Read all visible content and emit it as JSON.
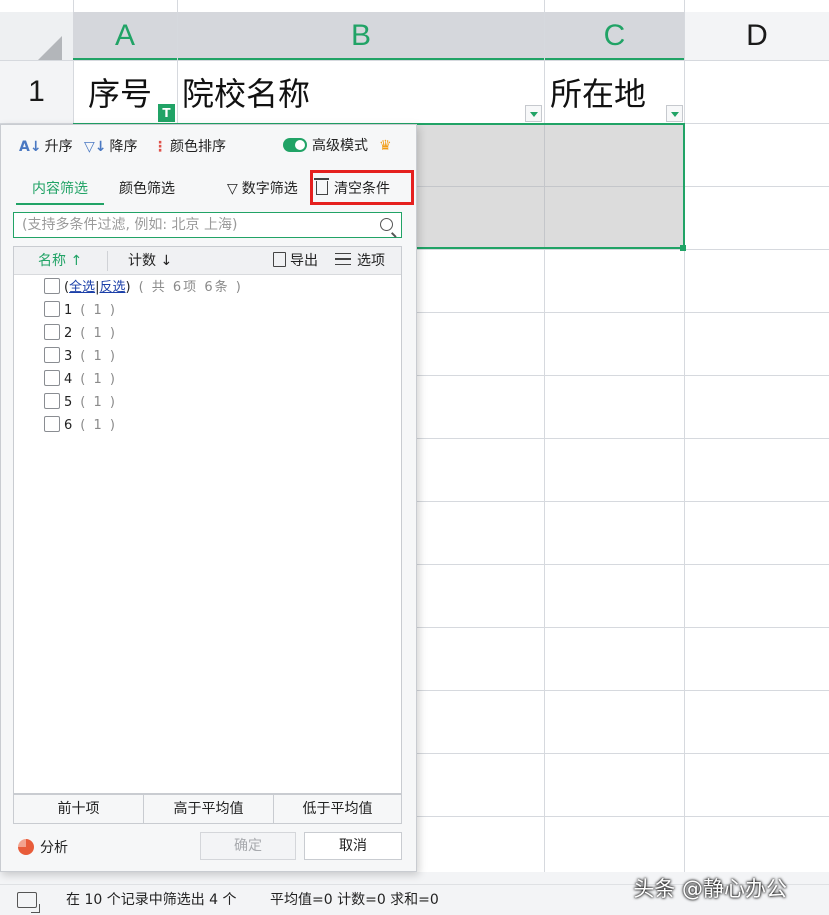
{
  "spreadsheet": {
    "columns": [
      "A",
      "B",
      "C",
      "D"
    ],
    "row_number": "1",
    "headers": {
      "a": "序号",
      "b": "院校名称",
      "c": "所在地"
    },
    "filter_active_icon": "T"
  },
  "filter_panel": {
    "sort": {
      "ascending": "升序",
      "descending": "降序",
      "color_sort": "颜色排序",
      "advanced_mode": "高级模式"
    },
    "tabs": {
      "content_filter": "内容筛选",
      "color_filter": "颜色筛选"
    },
    "number_filter": "数字筛选",
    "clear_conditions": "清空条件",
    "search": {
      "placeholder": "(支持多条件过滤, 例如: 北京 上海)"
    },
    "list_header": {
      "name": "名称",
      "name_arrow": "↑",
      "count": "计数",
      "count_arrow": "↓",
      "export": "导出",
      "options": "选项"
    },
    "select_all": {
      "all": "全选",
      "invert": "反选",
      "summary": "( 共 6项 6条 )"
    },
    "items": [
      {
        "label": "1",
        "count": "( 1 )"
      },
      {
        "label": "2",
        "count": "( 1 )"
      },
      {
        "label": "3",
        "count": "( 1 )"
      },
      {
        "label": "4",
        "count": "( 1 )"
      },
      {
        "label": "5",
        "count": "( 1 )"
      },
      {
        "label": "6",
        "count": "( 1 )"
      }
    ],
    "bottom_buttons": {
      "top_ten": "前十项",
      "above_average": "高于平均值",
      "below_average": "低于平均值"
    },
    "analysis": "分析",
    "ok": "确定",
    "cancel": "取消"
  },
  "status_bar": {
    "filter_info": "在 10 个记录中筛选出 4 个",
    "stats": "平均值=0 计数=0 求和=0"
  },
  "watermark": "头条 @静心办公",
  "colors": {
    "accent_green": "#21a366",
    "highlight_red": "#e5201f",
    "crown_orange": "#f29b12"
  }
}
